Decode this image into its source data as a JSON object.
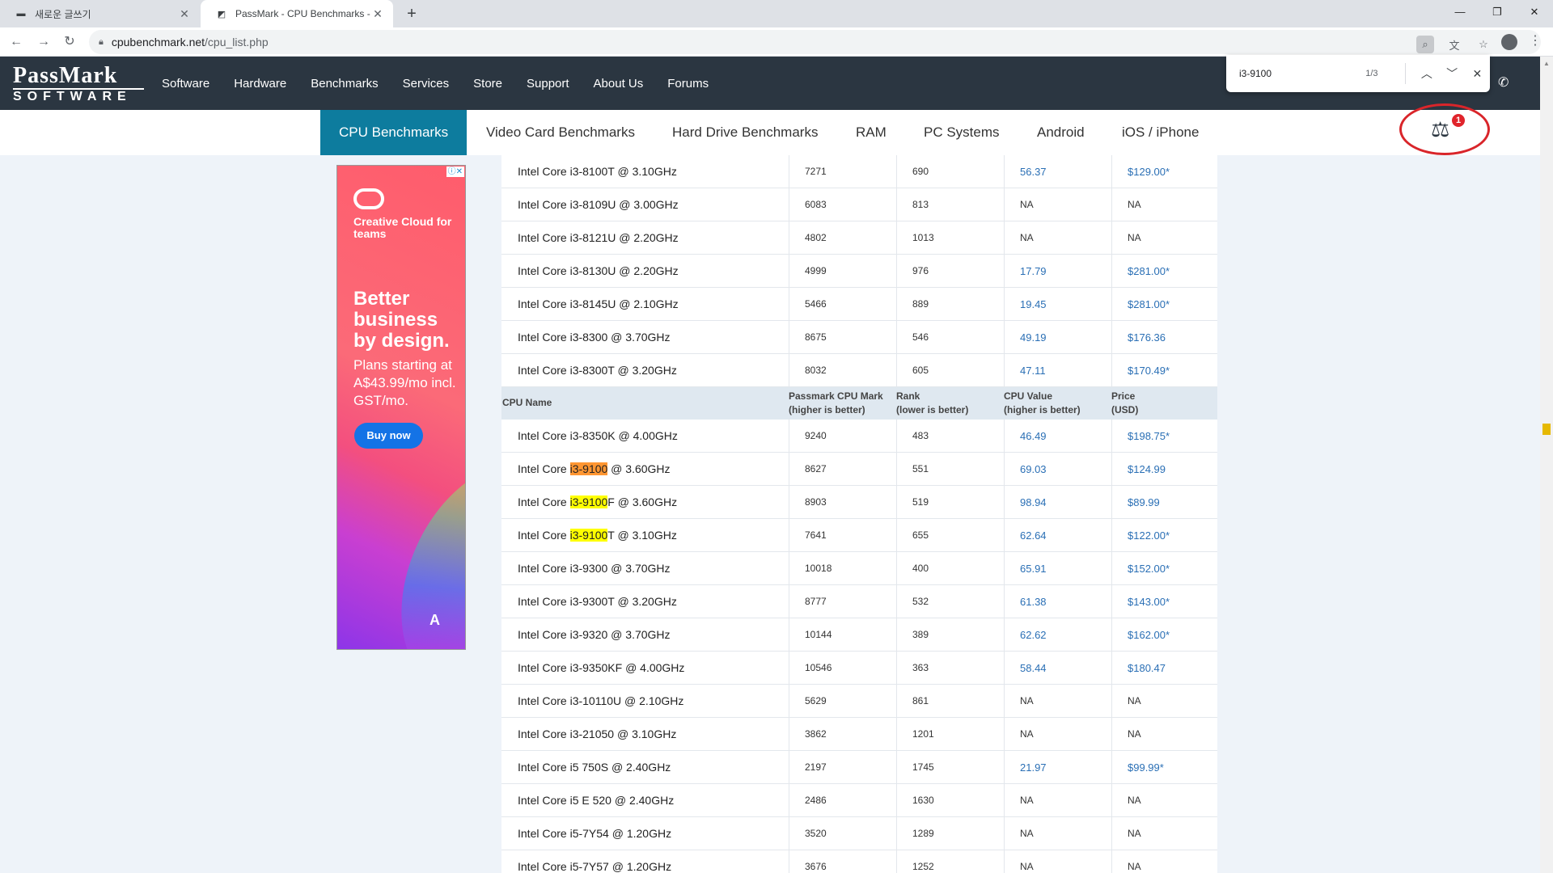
{
  "browser": {
    "tabs": [
      {
        "title": "새로운 글쓰기",
        "active": false
      },
      {
        "title": "PassMark - CPU Benchmarks - L",
        "active": true
      }
    ],
    "url_host": "cpubenchmark.net",
    "url_path": "/cpu_list.php"
  },
  "find": {
    "query": "i3-9100",
    "count": "1/3"
  },
  "site": {
    "logo_top": "PassMark",
    "logo_bottom": "SOFTWARE",
    "nav": [
      "Software",
      "Hardware",
      "Benchmarks",
      "Services",
      "Store",
      "Support",
      "About Us",
      "Forums"
    ],
    "subnav": [
      "CPU Benchmarks",
      "Video Card Benchmarks",
      "Hard Drive Benchmarks",
      "RAM",
      "PC Systems",
      "Android",
      "iOS / iPhone"
    ],
    "compare_badge": "1"
  },
  "ad": {
    "brand": "Creative Cloud for teams",
    "headline": "Better business by design.",
    "sub": "Plans starting at A$43.99/mo incl. GST/mo.",
    "button": "Buy now",
    "maker": "Adobe"
  },
  "table": {
    "headers": {
      "cpu": "CPU Name",
      "mark1": "Passmark CPU Mark",
      "mark2": "(higher is better)",
      "rank1": "Rank",
      "rank2": "(lower is better)",
      "value1": "CPU Value",
      "value2": "(higher is better)",
      "price1": "Price",
      "price2": "(USD)"
    },
    "rows_top": [
      {
        "name": "Intel Core i3-8100T @ 3.10GHz",
        "mark": "7271",
        "rank": "690",
        "value": "56.37",
        "price": "$129.00*"
      },
      {
        "name": "Intel Core i3-8109U @ 3.00GHz",
        "mark": "6083",
        "rank": "813",
        "value": "NA",
        "price": "NA"
      },
      {
        "name": "Intel Core i3-8121U @ 2.20GHz",
        "mark": "4802",
        "rank": "1013",
        "value": "NA",
        "price": "NA"
      },
      {
        "name": "Intel Core i3-8130U @ 2.20GHz",
        "mark": "4999",
        "rank": "976",
        "value": "17.79",
        "price": "$281.00*"
      },
      {
        "name": "Intel Core i3-8145U @ 2.10GHz",
        "mark": "5466",
        "rank": "889",
        "value": "19.45",
        "price": "$281.00*"
      },
      {
        "name": "Intel Core i3-8300 @ 3.70GHz",
        "mark": "8675",
        "rank": "546",
        "value": "49.19",
        "price": "$176.36"
      },
      {
        "name": "Intel Core i3-8300T @ 3.20GHz",
        "mark": "8032",
        "rank": "605",
        "value": "47.11",
        "price": "$170.49*"
      }
    ],
    "rows_bottom": [
      {
        "name": "Intel Core i3-8350K @ 4.00GHz",
        "mark": "9240",
        "rank": "483",
        "value": "46.49",
        "price": "$198.75*"
      },
      {
        "pre": "Intel Core ",
        "hl": "i3-9100",
        "post": " @ 3.60GHz",
        "hl_type": "cur",
        "mark": "8627",
        "rank": "551",
        "value": "69.03",
        "price": "$124.99"
      },
      {
        "pre": "Intel Core ",
        "hl": "i3-9100",
        "post": "F @ 3.60GHz",
        "hl_type": "hit",
        "mark": "8903",
        "rank": "519",
        "value": "98.94",
        "price": "$89.99"
      },
      {
        "pre": "Intel Core ",
        "hl": "i3-9100",
        "post": "T @ 3.10GHz",
        "hl_type": "hit",
        "mark": "7641",
        "rank": "655",
        "value": "62.64",
        "price": "$122.00*"
      },
      {
        "name": "Intel Core i3-9300 @ 3.70GHz",
        "mark": "10018",
        "rank": "400",
        "value": "65.91",
        "price": "$152.00*"
      },
      {
        "name": "Intel Core i3-9300T @ 3.20GHz",
        "mark": "8777",
        "rank": "532",
        "value": "61.38",
        "price": "$143.00*"
      },
      {
        "name": "Intel Core i3-9320 @ 3.70GHz",
        "mark": "10144",
        "rank": "389",
        "value": "62.62",
        "price": "$162.00*"
      },
      {
        "name": "Intel Core i3-9350KF @ 4.00GHz",
        "mark": "10546",
        "rank": "363",
        "value": "58.44",
        "price": "$180.47"
      },
      {
        "name": "Intel Core i3-10110U @ 2.10GHz",
        "mark": "5629",
        "rank": "861",
        "value": "NA",
        "price": "NA"
      },
      {
        "name": "Intel Core i3-21050 @ 3.10GHz",
        "mark": "3862",
        "rank": "1201",
        "value": "NA",
        "price": "NA"
      },
      {
        "name": "Intel Core i5 750S @ 2.40GHz",
        "mark": "2197",
        "rank": "1745",
        "value": "21.97",
        "price": "$99.99*"
      },
      {
        "name": "Intel Core i5 E 520 @ 2.40GHz",
        "mark": "2486",
        "rank": "1630",
        "value": "NA",
        "price": "NA"
      },
      {
        "name": "Intel Core i5-7Y54 @ 1.20GHz",
        "mark": "3520",
        "rank": "1289",
        "value": "NA",
        "price": "NA"
      },
      {
        "name": "Intel Core i5-7Y57 @ 1.20GHz",
        "mark": "3676",
        "rank": "1252",
        "value": "NA",
        "price": "NA"
      }
    ]
  }
}
